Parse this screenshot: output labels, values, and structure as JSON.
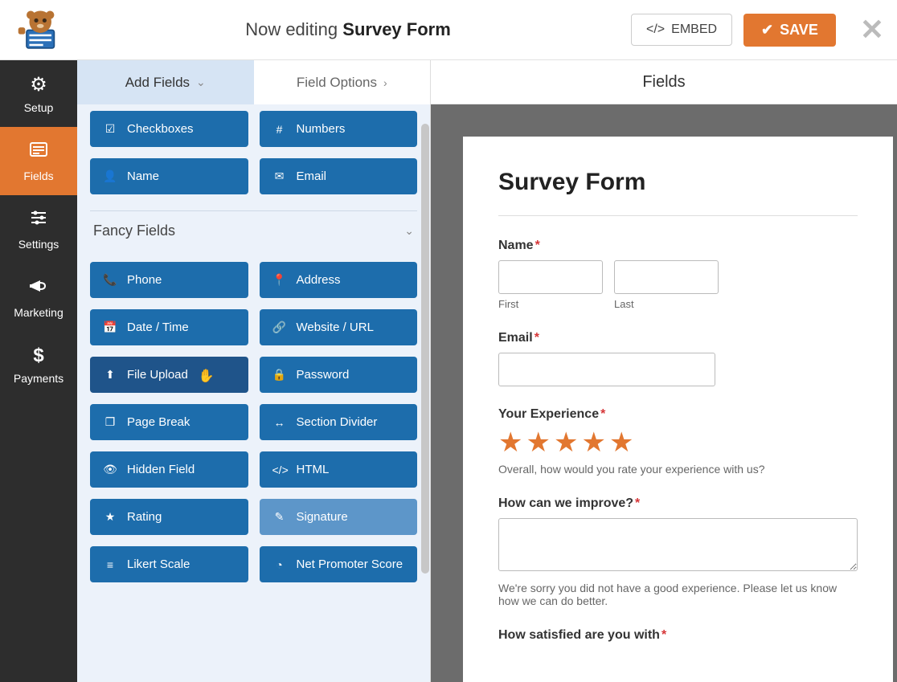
{
  "header": {
    "editing_prefix": "Now editing ",
    "form_name": "Survey Form",
    "embed_label": "EMBED",
    "save_label": "SAVE"
  },
  "rail": [
    {
      "key": "setup",
      "label": "Setup"
    },
    {
      "key": "fields",
      "label": "Fields"
    },
    {
      "key": "settings",
      "label": "Settings"
    },
    {
      "key": "marketing",
      "label": "Marketing"
    },
    {
      "key": "payments",
      "label": "Payments"
    }
  ],
  "stage_header": "Fields",
  "tabs": {
    "add_fields": "Add Fields",
    "field_options": "Field Options"
  },
  "standard_fields": [
    {
      "icon": "check-square",
      "label": "Checkboxes"
    },
    {
      "icon": "hash",
      "label": "Numbers"
    },
    {
      "icon": "user",
      "label": "Name"
    },
    {
      "icon": "envelope",
      "label": "Email"
    }
  ],
  "fancy_heading": "Fancy Fields",
  "fancy_fields": [
    {
      "icon": "phone",
      "label": "Phone"
    },
    {
      "icon": "map-marker",
      "label": "Address"
    },
    {
      "icon": "calendar",
      "label": "Date / Time"
    },
    {
      "icon": "link",
      "label": "Website / URL"
    },
    {
      "icon": "upload",
      "label": "File Upload",
      "hovered": true
    },
    {
      "icon": "lock",
      "label": "Password"
    },
    {
      "icon": "copy",
      "label": "Page Break"
    },
    {
      "icon": "arrows-h",
      "label": "Section Divider"
    },
    {
      "icon": "eye-slash",
      "label": "Hidden Field"
    },
    {
      "icon": "code",
      "label": "HTML"
    },
    {
      "icon": "star",
      "label": "Rating"
    },
    {
      "icon": "pencil",
      "label": "Signature",
      "faded": true
    },
    {
      "icon": "bars",
      "label": "Likert Scale"
    },
    {
      "icon": "dashboard",
      "label": "Net Promoter Score"
    }
  ],
  "form": {
    "title": "Survey Form",
    "name_label": "Name",
    "first": "First",
    "last": "Last",
    "email_label": "Email",
    "exp_label": "Your Experience",
    "exp_help": "Overall, how would you rate your experience with us?",
    "improve_label": "How can we improve?",
    "improve_help": "We're sorry you did not have a good experience. Please let us know how we can do better.",
    "satisfied_label": "How satisfied are you with"
  }
}
